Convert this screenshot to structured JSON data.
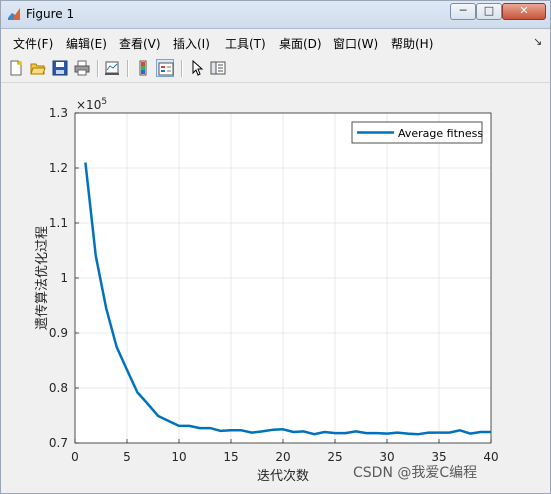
{
  "window": {
    "title": "Figure 1",
    "min_label": "─",
    "max_label": "□",
    "close_label": "✕"
  },
  "menu": {
    "items": [
      "文件(F)",
      "编辑(E)",
      "查看(V)",
      "插入(I)",
      "工具(T)",
      "桌面(D)",
      "窗口(W)",
      "帮助(H)"
    ],
    "overflow_arrow": "↘"
  },
  "toolbar": {
    "icons": [
      "new-figure-icon",
      "open-icon",
      "save-icon",
      "print-icon",
      "link-plot-icon",
      "colorbar-icon",
      "legend-icon",
      "pointer-icon",
      "property-editor-icon"
    ]
  },
  "chart_data": {
    "type": "line",
    "title": "",
    "xlabel": "迭代次数",
    "ylabel": "遗传算法优化过程",
    "y_exponent_label": "×10",
    "y_exponent_power": "5",
    "xlim": [
      0,
      40
    ],
    "ylim": [
      0.7,
      1.3
    ],
    "y_scale": 100000,
    "xticks": [
      0,
      5,
      10,
      15,
      20,
      25,
      30,
      35,
      40
    ],
    "yticks": [
      0.7,
      0.8,
      0.9,
      1,
      1.1,
      1.2,
      1.3
    ],
    "ytick_labels": [
      "0.7",
      "0.8",
      "0.9",
      "1",
      "1.1",
      "1.2",
      "1.3"
    ],
    "grid": true,
    "legend_position": "top-right",
    "series_color": "#0072bd",
    "series": [
      {
        "name": "Average fitness",
        "x": [
          1,
          2,
          3,
          4,
          5,
          6,
          7,
          8,
          9,
          10,
          11,
          12,
          13,
          14,
          15,
          16,
          17,
          18,
          19,
          20,
          21,
          22,
          23,
          24,
          25,
          26,
          27,
          28,
          29,
          30,
          31,
          32,
          33,
          34,
          35,
          36,
          37,
          38,
          39,
          40
        ],
        "values": [
          1.21,
          1.04,
          0.945,
          0.875,
          0.833,
          0.792,
          0.771,
          0.749,
          0.74,
          0.731,
          0.731,
          0.727,
          0.727,
          0.722,
          0.723,
          0.723,
          0.719,
          0.721,
          0.724,
          0.725,
          0.72,
          0.721,
          0.716,
          0.72,
          0.718,
          0.718,
          0.721,
          0.718,
          0.718,
          0.717,
          0.719,
          0.717,
          0.716,
          0.719,
          0.719,
          0.719,
          0.723,
          0.717,
          0.72,
          0.72
        ]
      }
    ]
  },
  "watermark": "CSDN @我爱C编程"
}
